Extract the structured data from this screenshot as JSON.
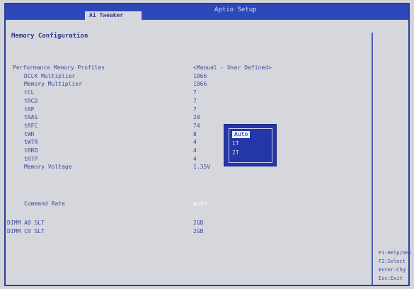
{
  "window": {
    "title": "Aptio Setup",
    "active_tab": "Ai Tweaker"
  },
  "page_title": "Memory Configuration",
  "settings": [
    {
      "label": "Performance Memory Profiles",
      "value": "<Manual - User Defined>"
    },
    {
      "label": "DCLK Multiplier",
      "value": "1066"
    },
    {
      "label": "Memory Multiplier",
      "value": "1066"
    },
    {
      "label": "tCL",
      "value": "7"
    },
    {
      "label": "tRCD",
      "value": "7"
    },
    {
      "label": "tRP",
      "value": "7"
    },
    {
      "label": "tRAS",
      "value": "20"
    },
    {
      "label": "tRFC",
      "value": "74"
    },
    {
      "label": "tWR",
      "value": "8"
    },
    {
      "label": "tWTR",
      "value": "4"
    },
    {
      "label": "tRRD",
      "value": "4"
    },
    {
      "label": "tRTP",
      "value": "4"
    },
    {
      "label": "Memory Voltage",
      "value": "1.35V"
    }
  ],
  "command_rate": {
    "label": "Command Rate",
    "value": "Auto"
  },
  "dimm_info": [
    {
      "label": "DIMM A0 SLT",
      "value": "2GB"
    },
    {
      "label": "DIMM C0 SLT",
      "value": "2GB"
    }
  ],
  "popup": {
    "options": [
      "Auto",
      "1T",
      "2T"
    ],
    "selected_index": 0
  },
  "help": [
    "F1:Help/Gen",
    "F2:Select",
    "Enter:Chg",
    "Esc:Exit"
  ],
  "colors": {
    "frame_blue": "#2d48b8",
    "popup_blue": "#2436a8",
    "text_blue": "#3a4aa3",
    "background": "#d6d7dc"
  }
}
